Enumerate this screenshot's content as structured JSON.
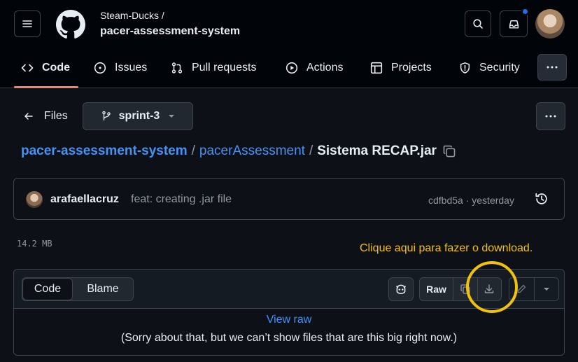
{
  "header": {
    "owner": "Steam-Ducks /",
    "repo": "pacer-assessment-system"
  },
  "tabs": [
    {
      "label": "Code",
      "icon": "code-icon"
    },
    {
      "label": "Issues",
      "icon": "issue-icon"
    },
    {
      "label": "Pull requests",
      "icon": "pull-request-icon"
    },
    {
      "label": "Actions",
      "icon": "play-icon"
    },
    {
      "label": "Projects",
      "icon": "table-icon"
    },
    {
      "label": "Security",
      "icon": "shield-icon"
    }
  ],
  "nav": {
    "files_label": "Files",
    "branch": "sprint-3"
  },
  "breadcrumb": {
    "repo": "pacer-assessment-system",
    "folder": "pacerAssessment",
    "file": "Sistema RECAP.jar"
  },
  "commit": {
    "author": "arafaellacruz",
    "message": "feat: creating .jar file",
    "meta": "cdfbd5a · yesterday"
  },
  "file": {
    "size": "14.2 MB",
    "annotation": "Clique aqui para fazer o download.",
    "code_tab": "Code",
    "blame_tab": "Blame",
    "raw_label": "Raw",
    "view_raw": "View raw",
    "too_big_message": "(Sorry about that, but we can’t show files that are this big right now.)"
  },
  "colors": {
    "background": "#0d1117",
    "header": "#010409",
    "link": "#4493f8",
    "active_tab": "#f78166",
    "annotation": "#f2c20a"
  }
}
